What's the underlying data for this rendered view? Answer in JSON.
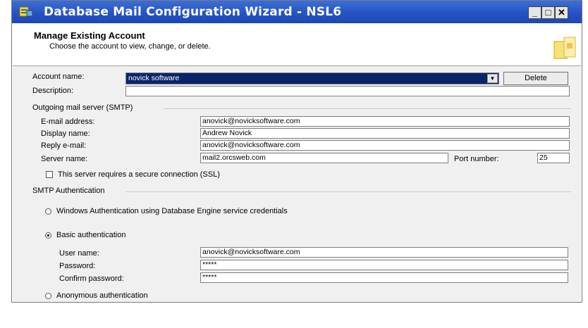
{
  "window": {
    "title": "Database Mail Configuration Wizard - NSL6",
    "minimize": "_",
    "maximize": "□",
    "close": "✕"
  },
  "header": {
    "title": "Manage Existing Account",
    "subtitle": "Choose the account to view, change, or delete."
  },
  "account": {
    "name_label": "Account name:",
    "name_value": "novick software",
    "delete_label": "Delete",
    "description_label": "Description:",
    "description_value": ""
  },
  "smtp": {
    "group_label": "Outgoing mail server (SMTP)",
    "email_label": "E-mail address:",
    "email_value": "anovick@novicksoftware.com",
    "display_label": "Display name:",
    "display_value": "Andrew Novick",
    "reply_label": "Reply e-mail:",
    "reply_value": "anovick@novicksoftware.com",
    "server_label": "Server name:",
    "server_value": "mail2.orcsweb.com",
    "port_label": "Port number:",
    "port_value": "25",
    "ssl_label": "This server requires a secure connection (SSL)",
    "ssl_checked": false
  },
  "auth": {
    "group_label": "SMTP Authentication",
    "windows_label": "Windows Authentication using Database Engine service credentials",
    "basic_label": "Basic authentication",
    "selected": "basic",
    "user_label": "User name:",
    "user_value": "anovick@novicksoftware.com",
    "password_label": "Password:",
    "password_value": "*****",
    "confirm_label": "Confirm password:",
    "confirm_value": "*****",
    "anonymous_label": "Anonymous authentication"
  },
  "colors": {
    "titlebar": "#2553c5",
    "selection": "#0a246a",
    "body": "#f0f0f0"
  }
}
